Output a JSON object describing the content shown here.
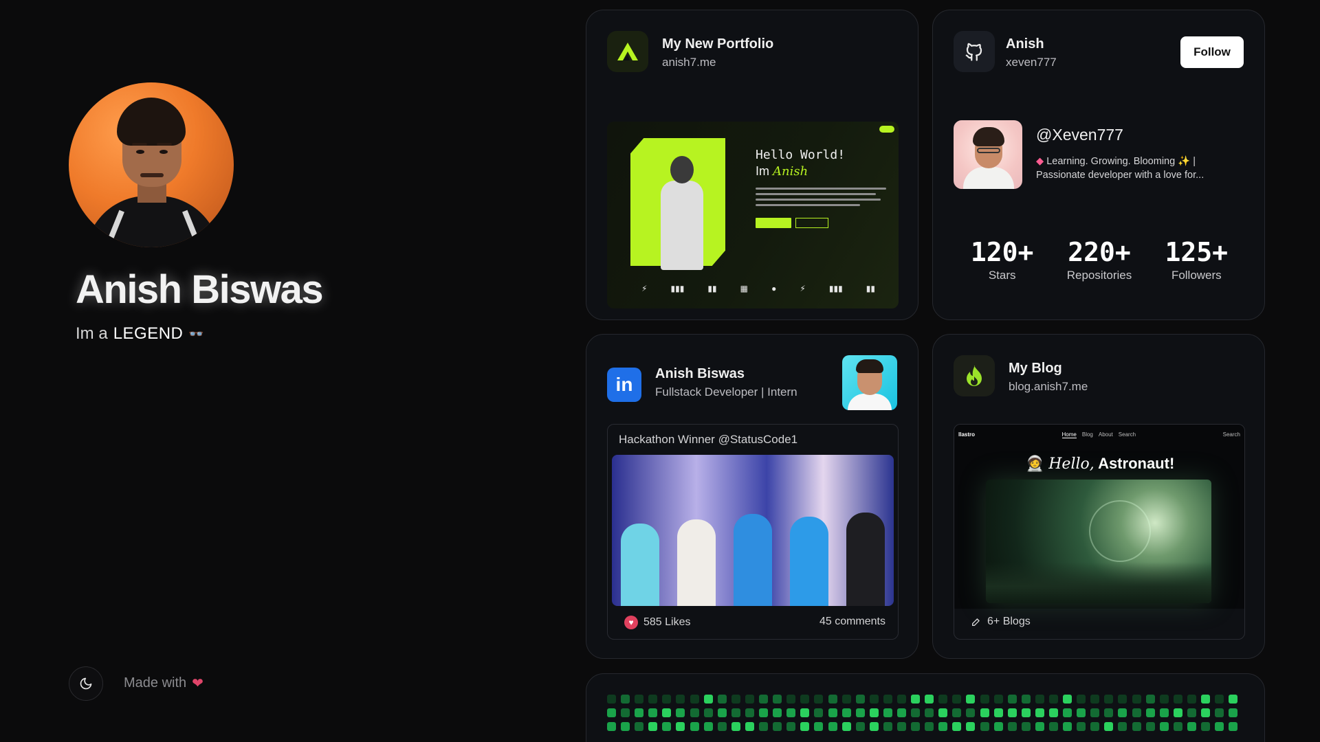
{
  "profile": {
    "name": "Anish Biswas",
    "tagline_prefix": "Im a",
    "tagline_word": "LEGEND",
    "tagline_emoji": "👓",
    "made_with": "Made with",
    "made_with_emoji": "❤"
  },
  "portfolio": {
    "title": "My New Portfolio",
    "url": "anish7.me",
    "preview": {
      "hello": "Hello World!",
      "im": "Im",
      "name": "Anish"
    }
  },
  "github": {
    "name": "Anish",
    "username": "xeven777",
    "follow_label": "Follow",
    "handle": "@Xeven777",
    "bio_line1": "Learning. Growing. Blooming",
    "bio_line2": "Passionate developer with a love for...",
    "stats": [
      {
        "value": "120+",
        "label": "Stars"
      },
      {
        "value": "220+",
        "label": "Repositories"
      },
      {
        "value": "125+",
        "label": "Followers"
      }
    ]
  },
  "linkedin": {
    "name": "Anish Biswas",
    "headline": "Fullstack Developer | Intern",
    "post_caption": "Hackathon Winner @StatusCode1",
    "likes": "585 Likes",
    "comments": "45 comments"
  },
  "blog": {
    "title": "My Blog",
    "url": "blog.anish7.me",
    "preview": {
      "brand": "llastro",
      "nav": [
        "Home",
        "Blog",
        "About",
        "Search"
      ],
      "search": "Search",
      "hello_italic": "Hello,",
      "hello_bold": "Astronaut!"
    },
    "count": "6+ Blogs"
  },
  "colors": {
    "accent_lime": "#b7f321",
    "github_tile": "#1a1d24",
    "linkedin_blue": "#1f6fe8",
    "blog_tile": "#1c1f18",
    "contrib_levels": [
      "#0e3b1f",
      "#136b33",
      "#1aa34a",
      "#2bd15e"
    ]
  }
}
